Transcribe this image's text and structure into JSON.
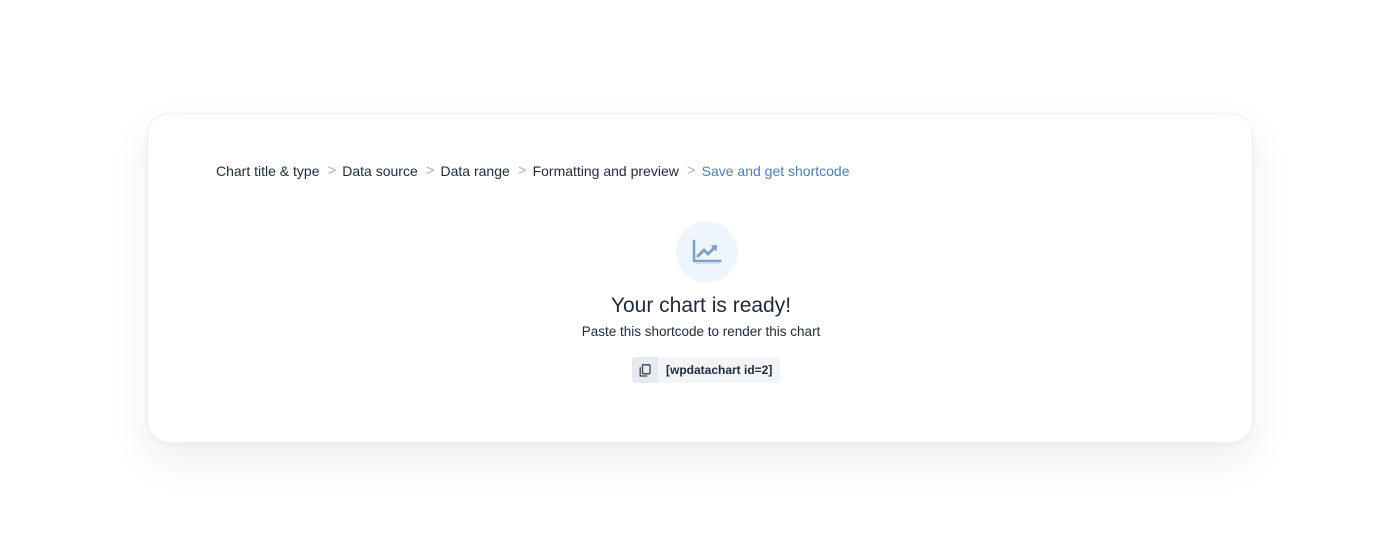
{
  "breadcrumb": {
    "items": [
      {
        "label": "Chart title & type"
      },
      {
        "label": "Data source"
      },
      {
        "label": "Data range"
      },
      {
        "label": "Formatting and preview"
      },
      {
        "label": "Save and get shortcode",
        "active": true
      }
    ],
    "separator": ">"
  },
  "hero": {
    "icon": "chart-trend-icon",
    "title": "Your chart is ready!",
    "subtitle": "Paste this shortcode to render this chart"
  },
  "shortcode": {
    "copy_icon": "copy-icon",
    "value": "[wpdatachart id=2]"
  },
  "colors": {
    "text": "#1e2a3a",
    "active_step": "#4f7fb0",
    "separator": "#a9b3c1",
    "icon_circle": "#eef6fc",
    "icon": "#7f9fc4"
  }
}
